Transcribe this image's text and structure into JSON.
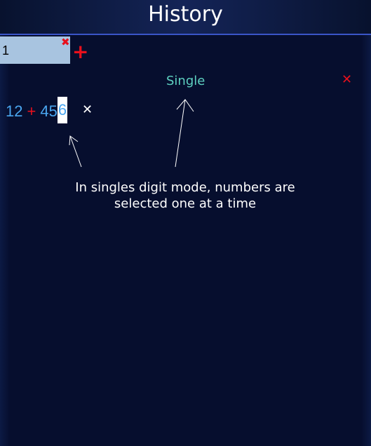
{
  "header": {
    "title": "History"
  },
  "tabs": [
    {
      "label": "1",
      "close_icon": "close-icon"
    }
  ],
  "tab_add_icon": "plus-icon",
  "mode": {
    "label": "Single"
  },
  "panel_close_icon": "close-icon",
  "expression": {
    "left": "12",
    "operator": "+",
    "right_prefix": "45",
    "right_selected": "6",
    "remove_icon": "close-icon"
  },
  "annotation": {
    "line1": "In singles digit mode, numbers are",
    "line2": "selected one at a time"
  },
  "colors": {
    "background": "#060e2e",
    "accent_red": "#e8101c",
    "number_blue": "#4aa6f0",
    "mode_teal": "#5dd0c0",
    "tab_bg": "#a8c4e0",
    "header_border": "#3a55c8"
  }
}
